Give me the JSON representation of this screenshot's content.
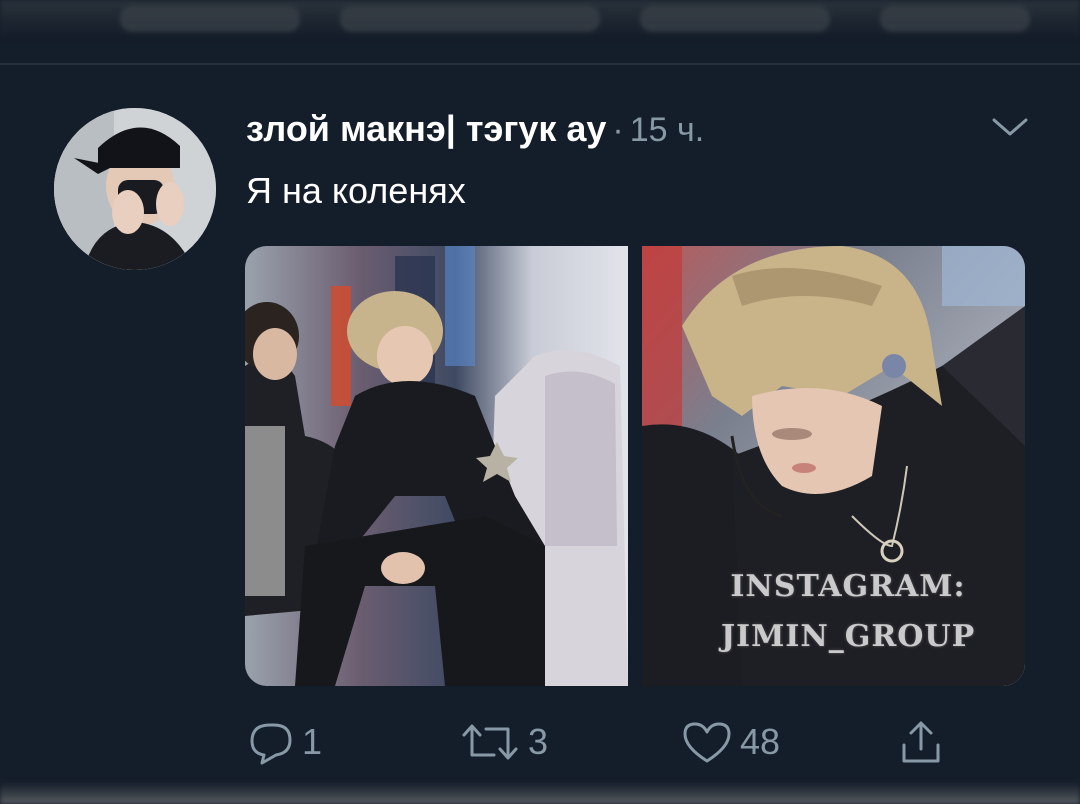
{
  "tweet": {
    "author": {
      "display_name": "злой макнэ| тэгук ау",
      "separator": "·",
      "time": "15 ч."
    },
    "text": "Я на коленях",
    "media": [
      {
        "alt_watermark": null
      },
      {
        "watermark_line1": "INSTAGRAM:",
        "watermark_line2": "JIMIN_GROUP"
      }
    ],
    "actions": {
      "reply": {
        "icon": "reply-icon",
        "count": "1"
      },
      "retweet": {
        "icon": "retweet-icon",
        "count": "3"
      },
      "like": {
        "icon": "heart-icon",
        "count": "48"
      },
      "share": {
        "icon": "share-icon"
      }
    },
    "menu_icon": "chevron-down-icon"
  },
  "colors": {
    "background": "#141d2a",
    "primary_text": "#ffffff",
    "secondary_text": "#8899a6"
  }
}
